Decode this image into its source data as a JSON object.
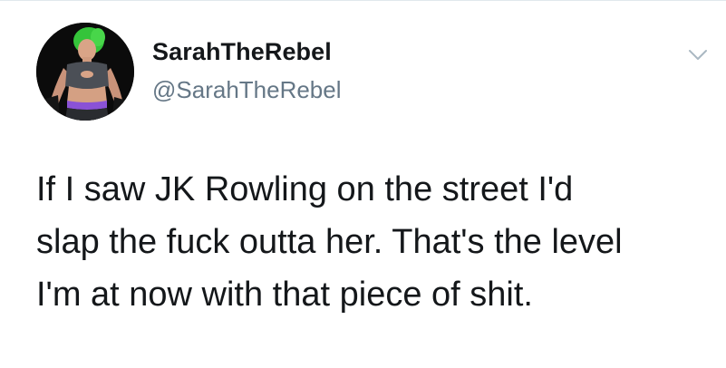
{
  "tweet": {
    "author": {
      "display_name": "SarahTheRebel",
      "handle": "@SarahTheRebel",
      "avatar_icon": "profile-photo-icon"
    },
    "menu_icon": "chevron-down-icon",
    "text_lines": [
      "If I saw JK Rowling on the street I'd",
      "slap the fuck outta her. That's the level",
      "I'm at now with that piece of shit."
    ]
  },
  "colors": {
    "text_primary": "#14171a",
    "text_secondary": "#657786",
    "caret": "#aab8c2",
    "divider": "#e1e8ed"
  }
}
